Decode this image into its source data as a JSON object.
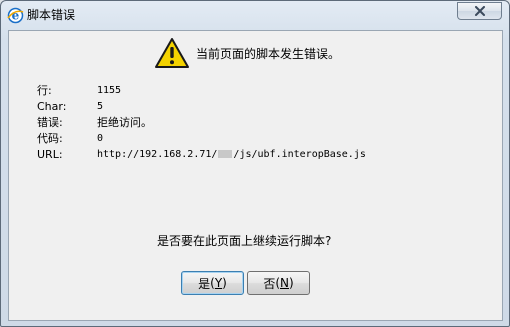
{
  "window": {
    "title": "脚本错误",
    "close_icon": "close-icon",
    "app_icon": "internet-explorer-icon"
  },
  "message": {
    "headline": "当前页面的脚本发生错误。",
    "icon": "warning-icon"
  },
  "details": [
    {
      "label": "行:",
      "value": "1155"
    },
    {
      "label": "Char:",
      "value": "5"
    },
    {
      "label": "错误:",
      "value": "拒绝访问。"
    },
    {
      "label": "代码:",
      "value": "0"
    },
    {
      "label": "URL:",
      "value_prefix": "http://192.168.2.71/",
      "value_suffix": "/js/ubf.interopBase.js"
    }
  ],
  "question": "是否要在此页面上继续运行脚本?",
  "buttons": {
    "yes": {
      "text": "是",
      "mnemonic_open": "(",
      "mnemonic_key": "Y",
      "mnemonic_close": ")"
    },
    "no": {
      "text": "否",
      "mnemonic_open": "(",
      "mnemonic_key": "N",
      "mnemonic_close": ")"
    }
  },
  "colors": {
    "warning_fill": "#f4d300",
    "warning_border": "#1a1a1a",
    "ie_blue": "#1a6fc8"
  }
}
